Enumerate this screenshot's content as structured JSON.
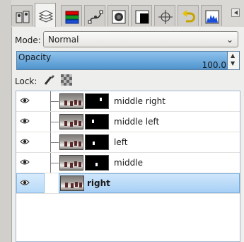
{
  "tabs": [
    {
      "name": "tool-options"
    },
    {
      "name": "layers",
      "active": true
    },
    {
      "name": "channels"
    },
    {
      "name": "paths"
    },
    {
      "name": "brushes"
    },
    {
      "name": "patterns"
    },
    {
      "name": "pointer"
    },
    {
      "name": "undo-history"
    },
    {
      "name": "histogram"
    }
  ],
  "mode": {
    "label": "Mode:",
    "value": "Normal"
  },
  "opacity": {
    "label": "Opacity",
    "value": "100.0",
    "fill_percent": 100
  },
  "lock": {
    "label": "Lock:"
  },
  "layers": [
    {
      "name": "middle right",
      "selected": false
    },
    {
      "name": "middle left",
      "selected": false
    },
    {
      "name": "left",
      "selected": false
    },
    {
      "name": "middle",
      "selected": false
    },
    {
      "name": "right",
      "selected": true
    }
  ],
  "colors": {
    "selection": "#a7d0f5",
    "opacity_bar": "#4f93cc"
  }
}
